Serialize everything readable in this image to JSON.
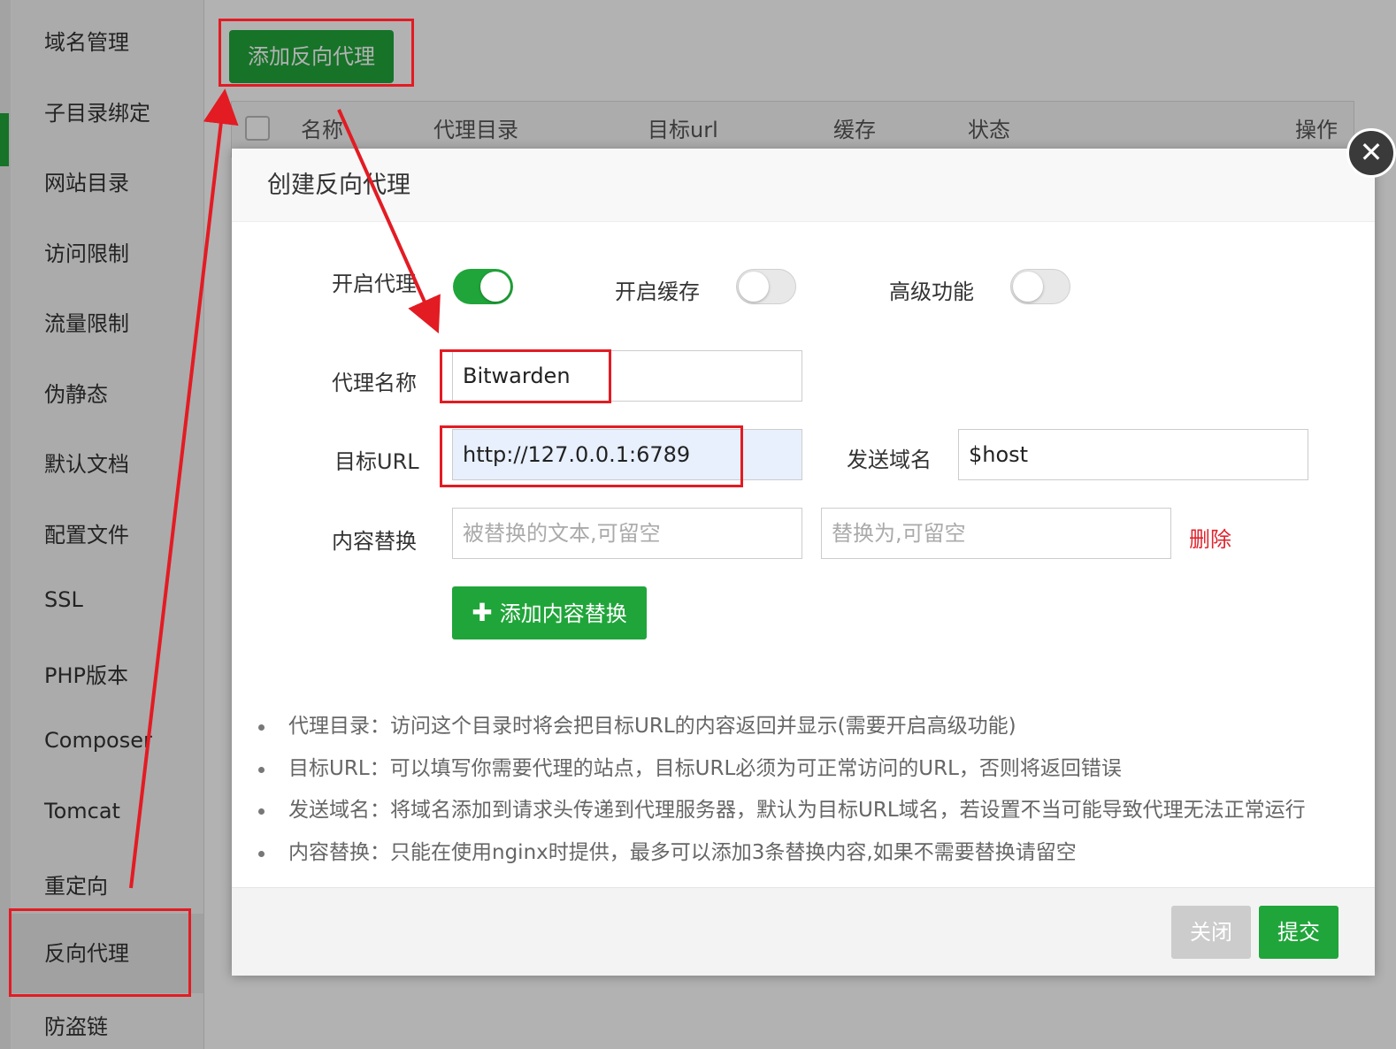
{
  "sidebar": {
    "items": [
      {
        "label": "域名管理"
      },
      {
        "label": "子目录绑定"
      },
      {
        "label": "网站目录"
      },
      {
        "label": "访问限制"
      },
      {
        "label": "流量限制"
      },
      {
        "label": "伪静态"
      },
      {
        "label": "默认文档"
      },
      {
        "label": "配置文件"
      },
      {
        "label": "SSL"
      },
      {
        "label": "PHP版本"
      },
      {
        "label": "Composer"
      },
      {
        "label": "Tomcat"
      },
      {
        "label": "重定向"
      },
      {
        "label": "反向代理",
        "active": true
      },
      {
        "label": "防盗链"
      }
    ]
  },
  "toolbar": {
    "add_proxy_label": "添加反向代理"
  },
  "table": {
    "columns": [
      "名称",
      "代理目录",
      "目标url",
      "缓存",
      "状态",
      "操作"
    ]
  },
  "modal": {
    "title": "创建反向代理",
    "close_icon": "close-icon",
    "toggles": {
      "enable_proxy": {
        "label": "开启代理",
        "on": true
      },
      "enable_cache": {
        "label": "开启缓存",
        "on": false
      },
      "advanced": {
        "label": "高级功能",
        "on": false
      }
    },
    "proxy_name": {
      "label": "代理名称",
      "value": "Bitwarden"
    },
    "target_url": {
      "label": "目标URL",
      "value": "http://127.0.0.1:6789"
    },
    "send_domain": {
      "label": "发送域名",
      "value": "$host"
    },
    "content_replace": {
      "label": "内容替换",
      "from_placeholder": "被替换的文本,可留空",
      "to_placeholder": "替换为,可留空",
      "delete_label": "删除"
    },
    "add_replace_label": "添加内容替换",
    "tips": [
      "代理目录：访问这个目录时将会把目标URL的内容返回并显示(需要开启高级功能)",
      "目标URL：可以填写你需要代理的站点，目标URL必须为可正常访问的URL，否则将返回错误",
      "发送域名：将域名添加到请求头传递到代理服务器，默认为目标URL域名，若设置不当可能导致代理无法正常运行",
      "内容替换：只能在使用nginx时提供，最多可以添加3条替换内容,如果不需要替换请留空"
    ],
    "footer": {
      "close_label": "关闭",
      "submit_label": "提交"
    }
  },
  "colors": {
    "brand_green": "#20a53a",
    "annotation_red": "#e31b23",
    "delete_red": "#e0242d"
  }
}
